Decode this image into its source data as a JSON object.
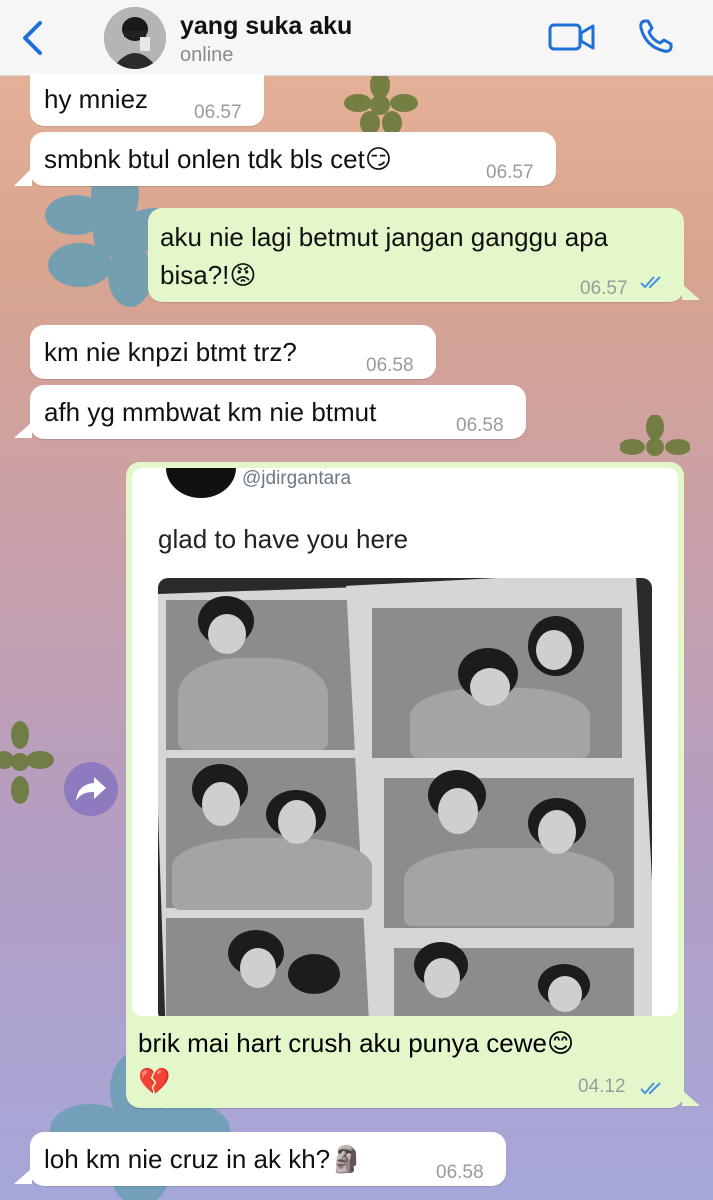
{
  "header": {
    "back_icon": "chevron-left-icon",
    "title": "yang suka aku",
    "status": "online",
    "video_icon": "video-call-icon",
    "phone_icon": "phone-icon",
    "accent": "#1f6fd8"
  },
  "messages": [
    {
      "direction": "in",
      "text": "hy mniez",
      "time": "06.57"
    },
    {
      "direction": "in",
      "text": "smbnk btul onlen tdk bls cet😏",
      "time": "06.57"
    },
    {
      "direction": "out",
      "lines": [
        "aku nie lagi betmut jangan ganggu apa",
        "bisa?!😡"
      ],
      "time": "06.57",
      "read": true
    },
    {
      "direction": "in",
      "text": "km nie knpzi btmt trz?",
      "time": "06.58"
    },
    {
      "direction": "in",
      "text": "afh yg mmbwat km nie btmut",
      "time": "06.58"
    },
    {
      "direction": "out",
      "type": "media",
      "tweet_handle": "@jdirgantara",
      "tweet_text": "glad to have you here",
      "caption_lines": [
        "brik mai hart crush aku punya cewe😊",
        "💔"
      ],
      "time": "04.12",
      "read": true
    },
    {
      "direction": "in",
      "text": "loh km nie cruz in ak kh?🗿",
      "time": "06.58"
    }
  ],
  "forward_icon": "forward-arrow-icon",
  "colors": {
    "incoming": "#ffffff",
    "outgoing": "#e3f7cb",
    "read_ticks": "#4a90e2",
    "forward_button": "#8e7bbf"
  }
}
